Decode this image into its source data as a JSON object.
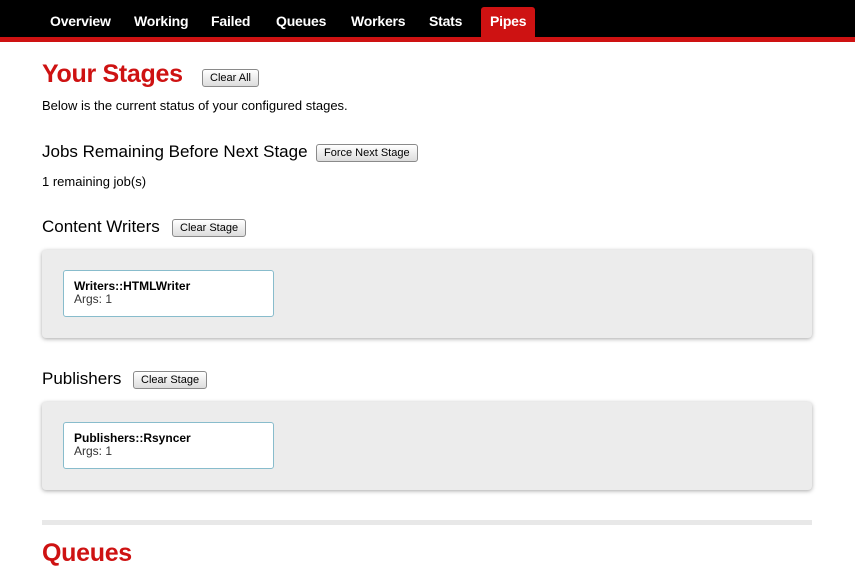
{
  "nav": {
    "tabs": [
      {
        "label": "Overview"
      },
      {
        "label": "Working"
      },
      {
        "label": "Failed"
      },
      {
        "label": "Queues"
      },
      {
        "label": "Workers"
      },
      {
        "label": "Stats"
      },
      {
        "label": "Pipes",
        "active": true
      }
    ]
  },
  "stages": {
    "title": "Your Stages",
    "clear_all_label": "Clear All",
    "description": "Below is the current status of your configured stages.",
    "remaining": {
      "heading": "Jobs Remaining Before Next Stage",
      "force_label": "Force Next Stage",
      "count_text": "1 remaining job(s)"
    },
    "groups": [
      {
        "heading": "Content Writers",
        "clear_label": "Clear Stage",
        "jobs": [
          {
            "name": "Writers::HTMLWriter",
            "args": "Args: 1"
          }
        ]
      },
      {
        "heading": "Publishers",
        "clear_label": "Clear Stage",
        "jobs": [
          {
            "name": "Publishers::Rsyncer",
            "args": "Args: 1"
          }
        ]
      }
    ]
  },
  "queues": {
    "title": "Queues"
  },
  "colors": {
    "accent": "#ce1212",
    "nav_background": "#000000",
    "stage_box": "#ececec",
    "card_border": "#88bccc"
  }
}
